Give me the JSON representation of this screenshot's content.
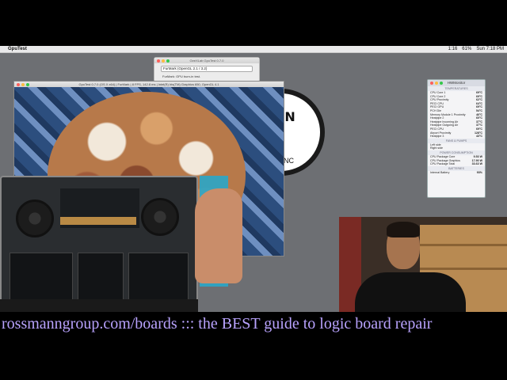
{
  "menubar": {
    "app_name": "GpuTest",
    "right_items": [
      "1:16",
      "61%",
      "Sun 7:18 PM"
    ]
  },
  "launcher": {
    "title": "GeeXLab GpuTest 0.7.0",
    "selected_test": "FurMark (OpenGL 2.1 / 3.2)",
    "note": "FurMark: GPU burn-in test."
  },
  "furmark": {
    "title": "GpuTest 0.7.0 (OS X x64) | FurMark | 8 FPS, 142.8 ms | Intel(R) Iris(TM) Graphics 650, OpenGL 4.1"
  },
  "hwmonitor": {
    "title": "HWMonitor",
    "temperatures_label": "TEMPERATURES",
    "temperatures": [
      {
        "name": "CPU Core 1",
        "value": "69°C"
      },
      {
        "name": "CPU Core 2",
        "value": "69°C"
      },
      {
        "name": "CPU Proximity",
        "value": "62°C"
      },
      {
        "name": "PECI CPU",
        "value": "64°C"
      },
      {
        "name": "PECI GPU",
        "value": "69°C"
      },
      {
        "name": "PCH Die",
        "value": "54°C"
      },
      {
        "name": "Memory Module 1 Proximity",
        "value": "46°C"
      },
      {
        "name": "Heatpipe 2",
        "value": "60°C"
      },
      {
        "name": "Heatpipe Incoming Air",
        "value": "37°C"
      },
      {
        "name": "Heatpipe Outgoing Air",
        "value": "37°C"
      },
      {
        "name": "PECI CPU",
        "value": "69°C"
      },
      {
        "name": "Airport Proximity",
        "value": "128°C"
      },
      {
        "name": "Heatpipe 3",
        "value": "43°C"
      }
    ],
    "fans_label": "FANS & PUMPS",
    "fans": [
      {
        "name": "Left side",
        "value": ""
      },
      {
        "name": "Right side",
        "value": ""
      }
    ],
    "power_label": "POWER CONSUMPTION",
    "power": [
      {
        "name": "CPU Package Core",
        "value": "9.53 W"
      },
      {
        "name": "CPU Package Graphics",
        "value": "17.90 W"
      },
      {
        "name": "CPU Package Total",
        "value": "33.63 W"
      }
    ],
    "batteries_label": "BATTERIES",
    "batteries": [
      {
        "name": "Internal Battery",
        "value": "93%"
      }
    ]
  },
  "logo": {
    "text": "NN",
    "sub": "NC"
  },
  "banner": {
    "text": "rossmanngroup.com/boards ::: the BEST guide to logic board repair"
  }
}
